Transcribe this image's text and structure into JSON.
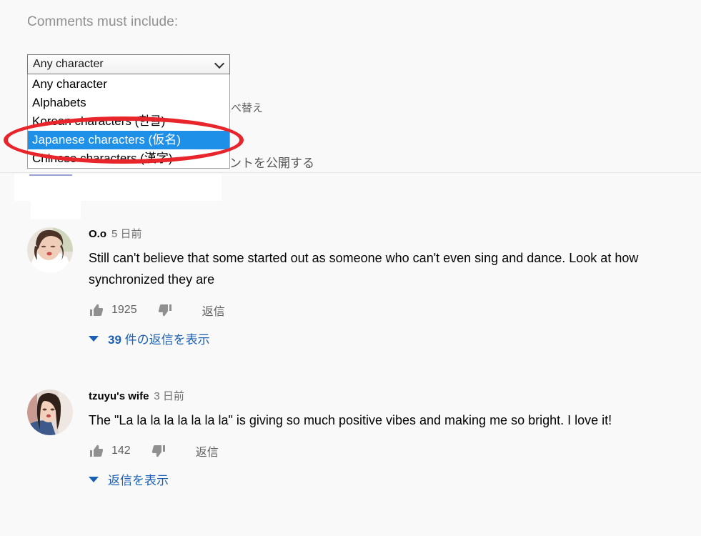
{
  "panel": {
    "title": "Comments must include:"
  },
  "filter_select": {
    "name": "comment-character-filter",
    "value": "Any character",
    "expanded": true,
    "highlight_color": "#1e90e8",
    "options": [
      "Any character",
      "Alphabets",
      "Korean characters (한글)",
      "Japanese characters (仮名)",
      "Chinese characters (漢字)"
    ],
    "selected_index": 3
  },
  "annotation": {
    "shape": "ellipse",
    "color": "#e8252a",
    "target": "Japanese characters (仮名)"
  },
  "background_ui": {
    "sort_label": "並べ替え",
    "publish_label": "てコメントを公開する"
  },
  "comments": [
    {
      "author": "O.o",
      "time": "5 日前",
      "text": "Still can't believe that some started out as someone who can't even sing and dance. Look at how synchronized they are",
      "likes": "1925",
      "reply_label": "返信",
      "replies_count": "39",
      "replies_label": " 件の返信を表示"
    },
    {
      "author": "tzuyu's wife",
      "time": "3 日前",
      "text": "The \"La la la la la la la la\" is giving so much positive vibes and making me so bright. I love it!",
      "likes": "142",
      "reply_label": "返信",
      "replies_count": "",
      "replies_label": "返信を表示"
    }
  ]
}
